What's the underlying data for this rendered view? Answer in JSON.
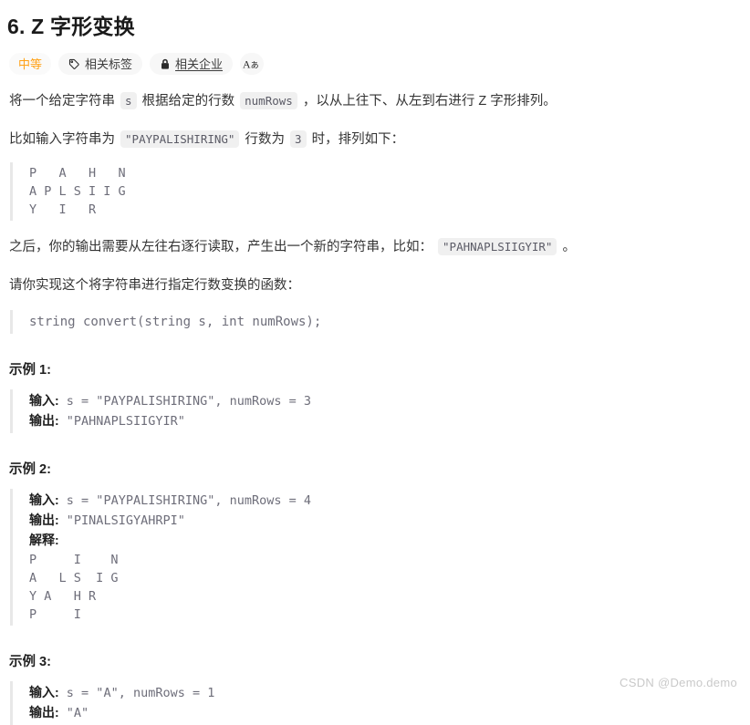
{
  "page": {
    "title": "6. Z 字形变换",
    "watermark": "CSDN @Demo.demo"
  },
  "badges": [
    {
      "label": "中等",
      "icon": "none",
      "kind": "difficulty"
    },
    {
      "label": "相关标签",
      "icon": "tag-icon",
      "kind": "normal"
    },
    {
      "label": "相关企业",
      "icon": "lock-icon",
      "kind": "normal"
    },
    {
      "label": "",
      "icon": "font-size-icon",
      "kind": "icon-only"
    }
  ],
  "intro": {
    "p1_part1": "将一个给定字符串",
    "p1_code1": "s",
    "p1_part2": "根据给定的行数",
    "p1_code2": "numRows",
    "p1_part3": "，以从上往下、从左到右进行 Z 字形排列。",
    "p2_part1": "比如输入字符串为",
    "p2_code1": "\"PAYPALISHIRING\"",
    "p2_part2": "行数为",
    "p2_code2": "3",
    "p2_part3": "时，排列如下：",
    "art": "P   A   H   N\nA P L S I I G\nY   I   R",
    "p3_part1": "之后，你的输出需要从左往右逐行读取，产生出一个新的字符串，比如：",
    "p3_code1": "\"PAHNAPLSIIGYIR\"",
    "p3_part2": "。",
    "p4": "请你实现这个将字符串进行指定行数变换的函数：",
    "signature": "string convert(string s, int numRows);"
  },
  "examples": [
    {
      "title": "示例 1:",
      "input_label": "输入:",
      "input_value": " s = \"PAYPALISHIRING\", numRows = 3",
      "output_label": "输出:",
      "output_value": " \"PAHNAPLSIIGYIR\"",
      "explain_label": "",
      "art": ""
    },
    {
      "title": "示例 2:",
      "input_label": "输入:",
      "input_value": " s = \"PAYPALISHIRING\", numRows = 4",
      "output_label": "输出:",
      "output_value": " \"PINALSIGYAHRPI\"",
      "explain_label": "解释:",
      "art": "P     I    N\nA   L S  I G\nY A   H R\nP     I"
    },
    {
      "title": "示例 3:",
      "input_label": "输入:",
      "input_value": " s = \"A\", numRows = 1",
      "output_label": "输出:",
      "output_value": " \"A\"",
      "explain_label": "",
      "art": ""
    }
  ],
  "colors": {
    "accent_difficulty": "#ffa116",
    "code_text": "#6e6e7a",
    "chip_bg": "#f0f0f0",
    "quote_border": "#e8e8e8",
    "watermark": "#c9c9c9"
  }
}
